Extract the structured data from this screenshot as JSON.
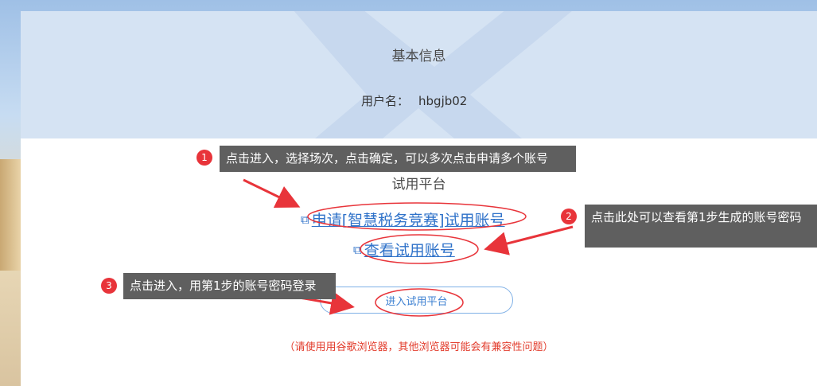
{
  "header": {
    "title": "基本信息",
    "username_label": "用户名：",
    "username_value": "hbgjb02"
  },
  "section": {
    "title": "试用平台",
    "apply_icon": "external-link-icon",
    "apply_link": "申请[智慧税务竞赛]试用账号",
    "view_icon": "search-doc-icon",
    "view_link": "查看试用账号",
    "enter_button": "进入试用平台",
    "notice": "（请使用用谷歌浏览器，其他浏览器可能会有兼容性问题）"
  },
  "annotations": [
    {
      "number": "1",
      "text": "点击进入，选择场次，点击确定，可以多次点击申请多个账号"
    },
    {
      "number": "2",
      "text": "点击此处可以查看第1步生成的账号密码"
    },
    {
      "number": "3",
      "text": "点击进入，用第1步的账号密码登录"
    }
  ],
  "colors": {
    "link": "#2f72c9",
    "annotation_red": "#e8343a",
    "callout_bg": "#5f5f5f",
    "header_bg": "#d5e3f3",
    "notice": "#e23b2b"
  }
}
